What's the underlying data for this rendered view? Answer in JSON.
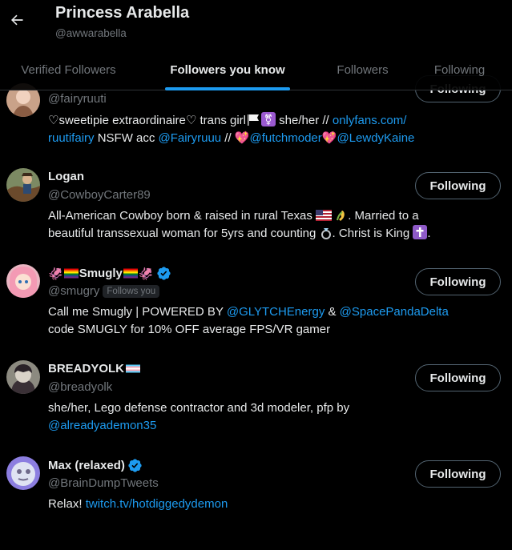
{
  "header": {
    "title": "Princess Arabella",
    "handle": "@awwarabella",
    "tabs": [
      "Verified Followers",
      "Followers you know",
      "Followers",
      "Following"
    ]
  },
  "users": [
    {
      "name": "",
      "handle": "@fairyruuti",
      "button": "Following",
      "bio_line1_a": "♡sweetipie extraordinaire♡ trans girl",
      "bio_line1_b": " she/her // ",
      "bio_line1_link": "onlyfans.com/",
      "bio_line2_link1": "ruutifairy",
      "bio_line2_a": " NSFW acc ",
      "bio_line2_link2": "@Fairyruuu",
      "bio_line2_b": " // ",
      "bio_line2_link3": "@futchmoder",
      "bio_line2_link4": "@LewdyKaine"
    },
    {
      "name": "Logan",
      "handle": "@CowboyCarter89",
      "button": "Following",
      "bio_line1_a": "All-American Cowboy born & raised in rural Texas",
      "bio_line1_b": ". Married to a",
      "bio_line2_a": "beautiful transsexual woman for 5yrs and counting",
      "bio_line2_b": ". Christ is King",
      "bio_line2_c": "."
    },
    {
      "name": "Smugly",
      "handle": "@smugry",
      "follows_you": "Follows you",
      "button": "Following",
      "bio_line1_a": "Call me Smugly | POWERED BY ",
      "bio_line1_link1": "@GLYTCHEnergy",
      "bio_line1_b": " & ",
      "bio_line1_link2": "@SpacePandaDelta",
      "bio_line2_a": "code SMUGLY for 10% OFF average FPS/VR gamer"
    },
    {
      "name": "BREADYOLK",
      "handle": "@breadyolk",
      "button": "Following",
      "bio_line1_a": "she/her, Lego defense contractor and 3d modeler, pfp by",
      "bio_line2_link": "@alreadyademon35"
    },
    {
      "name": "Max (relaxed)",
      "handle": "@BrainDumpTweets",
      "button": "Following",
      "bio_line1_a": "Relax! ",
      "bio_line1_link": "twitch.tv/hotdiggedydemon"
    }
  ],
  "colors": {
    "accent": "#1d9bf0",
    "text": "#e7e9ea",
    "muted": "#71767b",
    "background": "#000000"
  }
}
